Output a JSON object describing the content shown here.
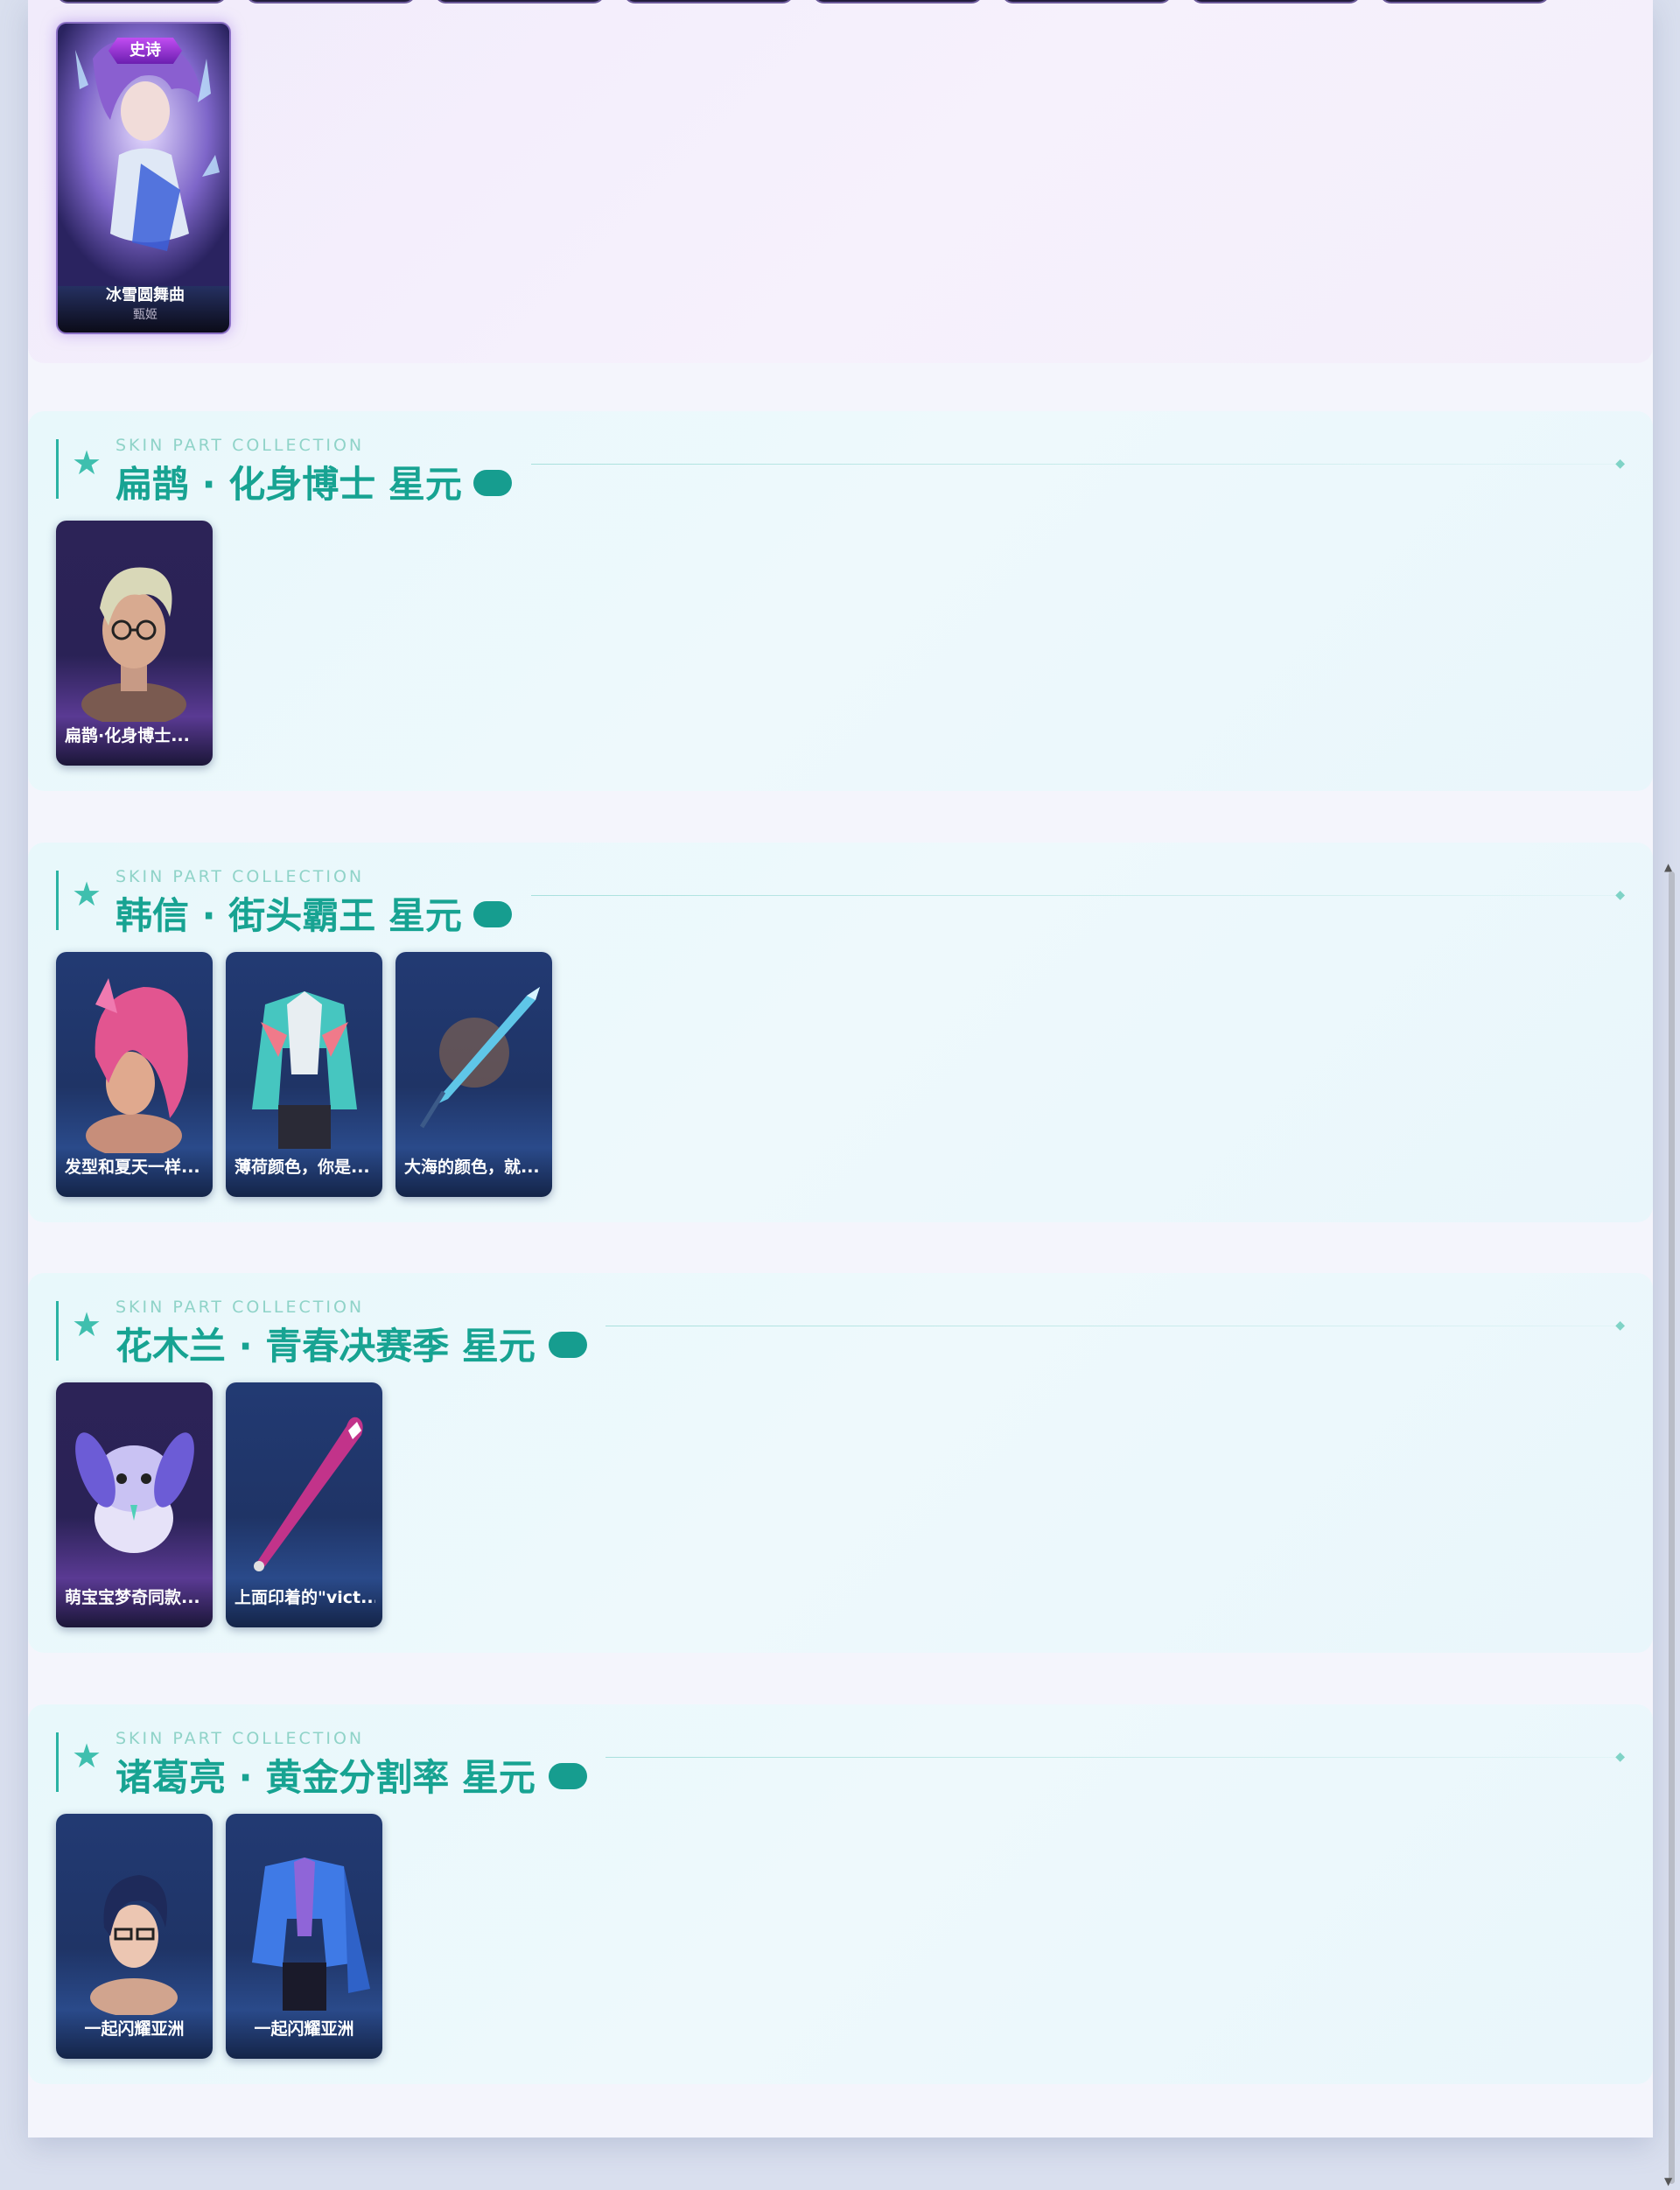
{
  "epic_section": {
    "card": {
      "badge": "史诗",
      "name": "冰雪圆舞曲",
      "hero": "甄姬"
    }
  },
  "sections": [
    {
      "subtitle": "SKIN PART COLLECTION",
      "title": "扁鹊 · 化身博士 星元",
      "items": [
        {
          "label": "扁鹊·化身博士...",
          "icon": "hero-head-glasses"
        }
      ]
    },
    {
      "subtitle": "SKIN PART COLLECTION",
      "title": "韩信 · 街头霸王 星元",
      "items": [
        {
          "label": "发型和夏天一样...",
          "icon": "pink-hair"
        },
        {
          "label": "薄荷颜色，你是...",
          "icon": "mint-jacket"
        },
        {
          "label": "大海的颜色，就...",
          "icon": "spear"
        }
      ]
    },
    {
      "subtitle": "SKIN PART COLLECTION",
      "title": "花木兰 · 青春决赛季 星元",
      "items": [
        {
          "label": "萌宝宝梦奇同款...",
          "icon": "plush-bunny"
        },
        {
          "label": "上面印着的\"vict...",
          "icon": "baseball-bat"
        }
      ]
    },
    {
      "subtitle": "SKIN PART COLLECTION",
      "title": "诸葛亮 · 黄金分割率 星元",
      "items": [
        {
          "label": "一起闪耀亚洲",
          "icon": "hero-head-dark-hair"
        },
        {
          "label": "一起闪耀亚洲",
          "icon": "blue-suit"
        }
      ]
    }
  ]
}
